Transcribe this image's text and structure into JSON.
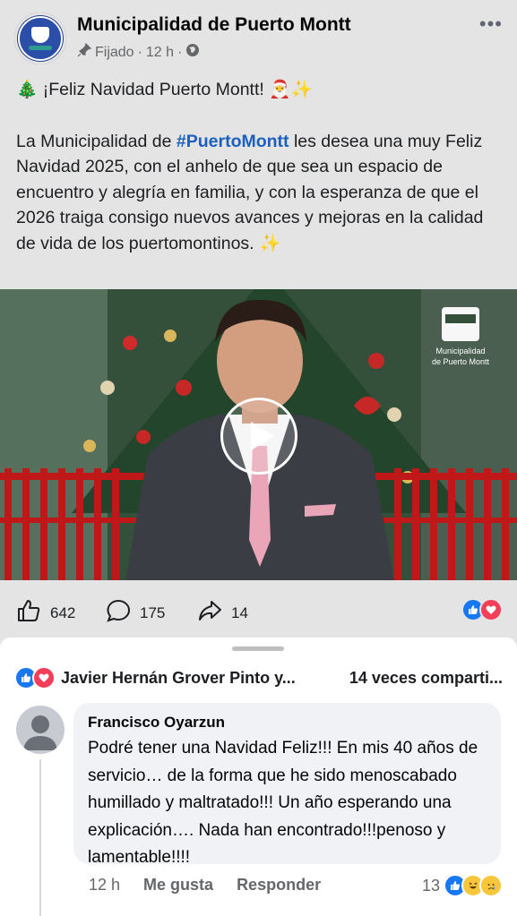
{
  "post": {
    "page_name": "Municipalidad de Puerto Montt",
    "pinned_label": "Fijado",
    "time": "12 h",
    "avatar_text": "Puerto Montt",
    "headline": "🎄 ¡Feliz Navidad Puerto Montt! 🎅✨",
    "body_prefix": "La Municipalidad de ",
    "hashtag": "#PuertoMontt",
    "body_suffix": " les desea una muy Feliz Navidad 2025, con el anhelo de que sea un espacio de encuentro y alegría en familia, y con la esperanza de que el 2026 traiga consigo nuevos avances y mejoras en la calidad de vida de los puertomontinos. ✨",
    "video_logo_line1": "Municipalidad",
    "video_logo_line2": "de Puerto Montt",
    "likes_count": "642",
    "comments_count": "175",
    "shares_count": "14"
  },
  "comments_sheet": {
    "reactors": "Javier Hernán Grover Pinto y...",
    "shares_text": "14 veces comparti...",
    "comment": {
      "author": "Francisco Oyarzun",
      "text": "Podré tener una Navidad Feliz!!! En mis 40 años de servicio… de la forma que he sido menoscabado humillado y maltratado!!! Un año esperando una explicación…. Nada han encontrado!!!penoso y lamentable!!!!",
      "time": "12 h",
      "like_action": "Me gusta",
      "reply_action": "Responder",
      "reaction_count": "13"
    }
  },
  "colors": {
    "accent": "#1877f2",
    "love": "#f33e58",
    "hashtag": "#1b5fbf"
  },
  "icons": [
    "more-icon",
    "pin-icon",
    "globe-icon",
    "like-icon",
    "comment-icon",
    "share-icon",
    "play-icon"
  ]
}
